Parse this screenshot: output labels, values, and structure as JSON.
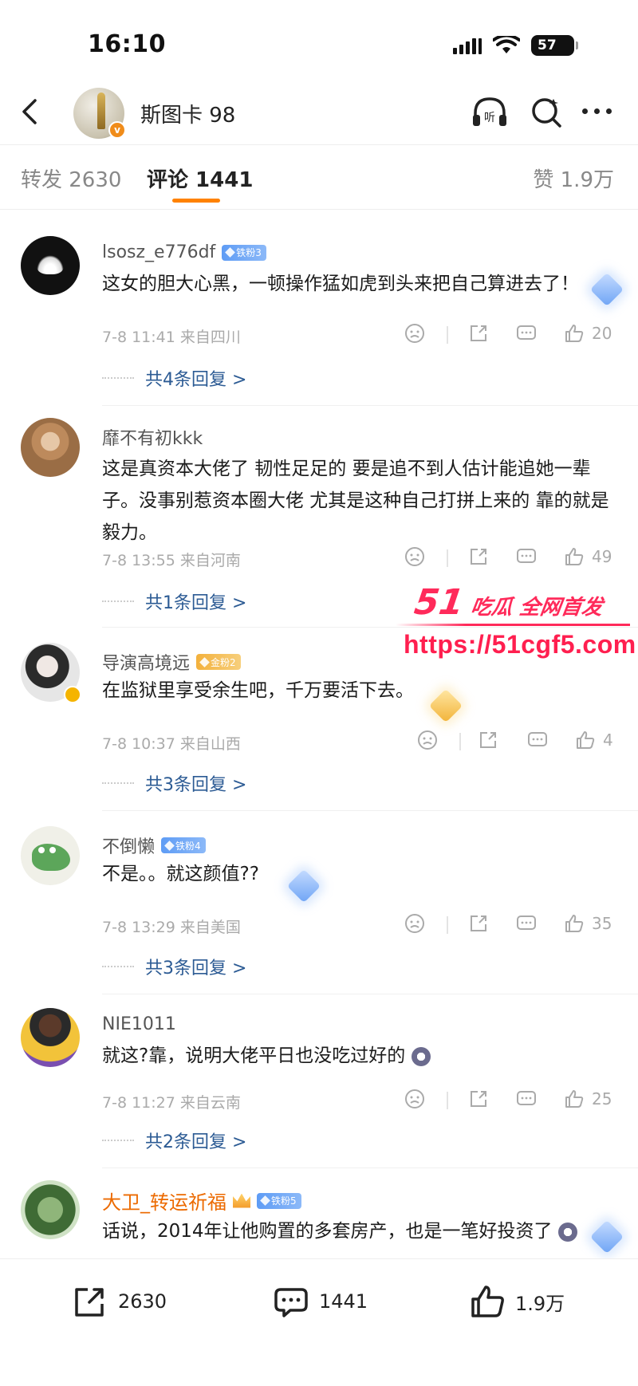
{
  "status": {
    "time": "16:10",
    "battery": "57"
  },
  "header": {
    "name": "斯图卡 98"
  },
  "tabs": {
    "repost": "转发 2630",
    "comment": "评论 1441",
    "like": "赞 1.9万"
  },
  "comments": [
    {
      "name": "lsosz_e776df",
      "badge": "铁粉3",
      "text": "这女的胆大心黑，一顿操作猛如虎到头来把自己算进去了！",
      "meta": "7-8 11:41 来自四川",
      "likes": "20",
      "replies": "共4条回复 >"
    },
    {
      "name": "靡不有初kkk",
      "badge": "",
      "text": "这是真资本大佬了 韧性足足的 要是追不到人估计能追她一辈子。没事别惹资本圈大佬 尤其是这种自己打拼上来的 靠的就是毅力。",
      "meta": "7-8 13:55 来自河南",
      "likes": "49",
      "replies": "共1条回复 >"
    },
    {
      "name": "导演高境远",
      "badge": "金粉2",
      "text": "在监狱里享受余生吧，千万要活下去。",
      "meta": "7-8 10:37 来自山西",
      "likes": "4",
      "replies": "共3条回复 >"
    },
    {
      "name": "不倒懒",
      "badge": "铁粉4",
      "text": "不是。。就这颜值??",
      "meta": "7-8 13:29 来自美国",
      "likes": "35",
      "replies": "共3条回复 >"
    },
    {
      "name": "NIE1011",
      "badge": "",
      "text": "就这?靠，说明大佬平日也没吃过好的",
      "meta": "7-8 11:27 来自云南",
      "likes": "25",
      "replies": "共2条回复 >"
    },
    {
      "name": "大卫_转运祈福",
      "badge": "铁粉5",
      "text": "话说，2014年让他购置的多套房产，也是一笔好投资了"
    }
  ],
  "watermark": {
    "brand_num": "51",
    "brand_text": "吃瓜 全网首发",
    "url": "https://51cgf5.com"
  },
  "bottom": {
    "repost": "2630",
    "comment": "1441",
    "like": "1.9万"
  },
  "colors": {
    "accent": "#ff8200",
    "link": "#2c5b94",
    "watermark": "#ff2a5a"
  }
}
